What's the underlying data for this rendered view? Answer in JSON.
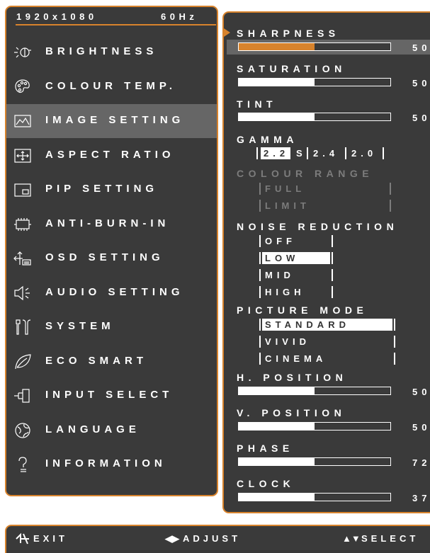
{
  "header": {
    "resolution": "1920x1080",
    "refresh": "60Hz"
  },
  "menu": [
    {
      "label": "BRIGHTNESS",
      "icon": "brightness-icon",
      "selected": false
    },
    {
      "label": "COLOUR TEMP.",
      "icon": "palette-icon",
      "selected": false
    },
    {
      "label": "IMAGE SETTING",
      "icon": "image-icon",
      "selected": true
    },
    {
      "label": "ASPECT RATIO",
      "icon": "aspect-ratio-icon",
      "selected": false
    },
    {
      "label": "PIP SETTING",
      "icon": "pip-icon",
      "selected": false
    },
    {
      "label": "ANTI-BURN-IN",
      "icon": "chip-icon",
      "selected": false
    },
    {
      "label": "OSD SETTING",
      "icon": "osd-icon",
      "selected": false
    },
    {
      "label": "AUDIO SETTING",
      "icon": "speaker-icon",
      "selected": false
    },
    {
      "label": "SYSTEM",
      "icon": "tools-icon",
      "selected": false
    },
    {
      "label": "ECO SMART",
      "icon": "leaf-icon",
      "selected": false
    },
    {
      "label": "INPUT SELECT",
      "icon": "plug-icon",
      "selected": false
    },
    {
      "label": "LANGUAGE",
      "icon": "globe-icon",
      "selected": false
    },
    {
      "label": "INFORMATION",
      "icon": "question-icon",
      "selected": false
    }
  ],
  "settings": {
    "sharpness": {
      "label": "SHARPNESS",
      "value": "50",
      "level": 0.5,
      "active": true
    },
    "saturation": {
      "label": "SATURATION",
      "value": "50",
      "level": 0.5
    },
    "tint": {
      "label": "TINT",
      "value": "50",
      "level": 0.5
    },
    "gamma": {
      "label": "GAMMA",
      "options": [
        "2.2",
        "S",
        "2.4",
        "2.0"
      ],
      "selected": "2.2"
    },
    "colour_range": {
      "label": "COLOUR RANGE",
      "options": [
        "FULL",
        "LIMIT"
      ],
      "disabled": true
    },
    "noise_reduction": {
      "label": "NOISE REDUCTION",
      "options": [
        "OFF",
        "LOW",
        "MID",
        "HIGH"
      ],
      "selected": "LOW"
    },
    "picture_mode": {
      "label": "PICTURE MODE",
      "options": [
        "STANDARD",
        "VIVID",
        "CINEMA"
      ],
      "selected": "STANDARD"
    },
    "h_position": {
      "label": "H. POSITION",
      "value": "50",
      "level": 0.5
    },
    "v_position": {
      "label": "V. POSITION",
      "value": "50",
      "level": 0.5
    },
    "phase": {
      "label": "PHASE",
      "value": "72",
      "level": 0.5
    },
    "clock": {
      "label": "CLOCK",
      "value": "37",
      "level": 0.5
    }
  },
  "footer": {
    "exit": "EXIT",
    "adjust": "ADJUST",
    "select": "SELECT"
  },
  "colors": {
    "accent": "#d8832c",
    "panel": "#3a3a3a",
    "highlight": "#666666",
    "disabled": "#7c7c7c"
  }
}
